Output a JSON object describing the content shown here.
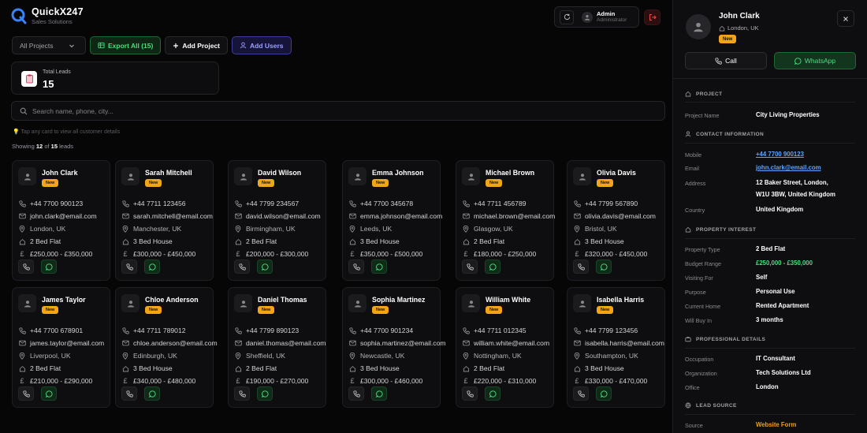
{
  "app": {
    "title": "QuickX247",
    "subtitle": "Sales Solutions"
  },
  "user": {
    "name": "Admin",
    "role": "Administrator"
  },
  "toolbar": {
    "project_select": "All Projects",
    "export_label": "Export All (15)",
    "add_project_label": "Add Project",
    "add_users_label": "Add Users"
  },
  "stats": {
    "total_leads_label": "Total Leads",
    "total_leads_value": "15"
  },
  "search": {
    "placeholder": "Search name, phone, city..."
  },
  "hint": {
    "icon": "💡",
    "text": "Tap any card to view all customer details"
  },
  "showing": {
    "prefix": "Showing",
    "shown": "12",
    "of": "of",
    "total": "15",
    "suffix": "leads"
  },
  "leads": [
    {
      "name": "John Clark",
      "status": "New",
      "phone": "+44 7700 900123",
      "email": "john.clark@email.com",
      "location": "London, UK",
      "property": "2 Bed Flat",
      "budget": "£250,000 - £350,000"
    },
    {
      "name": "Sarah Mitchell",
      "status": "New",
      "phone": "+44 7711 123456",
      "email": "sarah.mitchell@email.com",
      "location": "Manchester, UK",
      "property": "3 Bed House",
      "budget": "£300,000 - £450,000"
    },
    {
      "name": "David Wilson",
      "status": "New",
      "phone": "+44 7799 234567",
      "email": "david.wilson@email.com",
      "location": "Birmingham, UK",
      "property": "2 Bed Flat",
      "budget": "£200,000 - £300,000"
    },
    {
      "name": "Emma Johnson",
      "status": "New",
      "phone": "+44 7700 345678",
      "email": "emma.johnson@email.com",
      "location": "Leeds, UK",
      "property": "3 Bed House",
      "budget": "£350,000 - £500,000"
    },
    {
      "name": "Michael Brown",
      "status": "New",
      "phone": "+44 7711 456789",
      "email": "michael.brown@email.com",
      "location": "Glasgow, UK",
      "property": "2 Bed Flat",
      "budget": "£180,000 - £250,000"
    },
    {
      "name": "Olivia Davis",
      "status": "New",
      "phone": "+44 7799 567890",
      "email": "olivia.davis@email.com",
      "location": "Bristol, UK",
      "property": "3 Bed House",
      "budget": "£320,000 - £450,000"
    },
    {
      "name": "James Taylor",
      "status": "New",
      "phone": "+44 7700 678901",
      "email": "james.taylor@email.com",
      "location": "Liverpool, UK",
      "property": "2 Bed Flat",
      "budget": "£210,000 - £290,000"
    },
    {
      "name": "Chloe Anderson",
      "status": "New",
      "phone": "+44 7711 789012",
      "email": "chloe.anderson@email.com",
      "location": "Edinburgh, UK",
      "property": "3 Bed House",
      "budget": "£340,000 - £480,000"
    },
    {
      "name": "Daniel Thomas",
      "status": "New",
      "phone": "+44 7799 890123",
      "email": "daniel.thomas@email.com",
      "location": "Sheffield, UK",
      "property": "2 Bed Flat",
      "budget": "£190,000 - £270,000"
    },
    {
      "name": "Sophia Martinez",
      "status": "New",
      "phone": "+44 7700 901234",
      "email": "sophia.martinez@email.com",
      "location": "Newcastle, UK",
      "property": "3 Bed House",
      "budget": "£300,000 - £460,000"
    },
    {
      "name": "William White",
      "status": "New",
      "phone": "+44 7711 012345",
      "email": "william.white@email.com",
      "location": "Nottingham, UK",
      "property": "2 Bed Flat",
      "budget": "£220,000 - £310,000"
    },
    {
      "name": "Isabella Harris",
      "status": "New",
      "phone": "+44 7799 123456",
      "email": "isabella.harris@email.com",
      "location": "Southampton, UK",
      "property": "3 Bed House",
      "budget": "£330,000 - £470,000"
    }
  ],
  "detail": {
    "name": "John Clark",
    "location": "London, UK",
    "status": "New",
    "call_label": "Call",
    "whatsapp_label": "WhatsApp",
    "sections": {
      "project": "PROJECT",
      "contact": "CONTACT INFORMATION",
      "property": "PROPERTY INTEREST",
      "professional": "PROFESSIONAL DETAILS",
      "lead_source": "LEAD SOURCE"
    },
    "fields": {
      "project_name": {
        "label": "Project Name",
        "value": "City Living Properties"
      },
      "mobile": {
        "label": "Mobile",
        "value": "+44 7700 900123"
      },
      "email": {
        "label": "Email",
        "value": "john.clark@email.com"
      },
      "address": {
        "label": "Address",
        "line1": "12 Baker Street, London,",
        "line2": "W1U 3BW, United Kingdom"
      },
      "country": {
        "label": "Country",
        "value": "United Kingdom"
      },
      "property_type": {
        "label": "Property Type",
        "value": "2 Bed Flat"
      },
      "budget_range": {
        "label": "Budget Range",
        "value": "£250,000 - £350,000"
      },
      "visiting_for": {
        "label": "Visiting For",
        "value": "Self"
      },
      "purpose": {
        "label": "Purpose",
        "value": "Personal Use"
      },
      "current_home": {
        "label": "Current Home",
        "value": "Rented Apartment"
      },
      "will_buy_in": {
        "label": "Will Buy In",
        "value": "3 months"
      },
      "occupation": {
        "label": "Occupation",
        "value": "IT Consultant"
      },
      "organization": {
        "label": "Organization",
        "value": "Tech Solutions Ltd"
      },
      "office": {
        "label": "Office",
        "value": "London"
      },
      "source": {
        "label": "Source",
        "value": "Website Form"
      }
    }
  },
  "colors": {
    "accent_green": "#4ade80",
    "badge_orange": "#f2a516",
    "link_blue": "#60a5fa",
    "source_orange": "#f59e0b",
    "indigo": "#9aa0ff"
  }
}
